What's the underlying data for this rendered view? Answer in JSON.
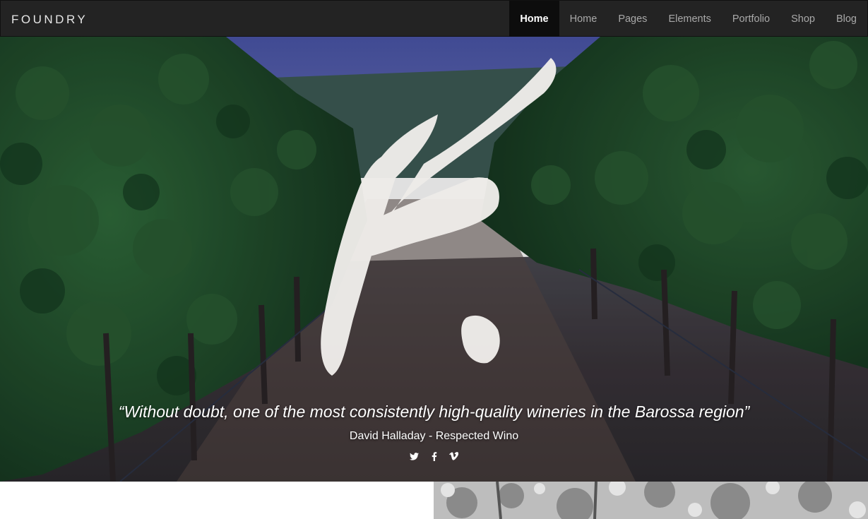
{
  "brand": {
    "logo_text": "FOUNDRY"
  },
  "nav": {
    "items": [
      {
        "label": "Home",
        "active": true
      },
      {
        "label": "Home",
        "active": false
      },
      {
        "label": "Pages",
        "active": false
      },
      {
        "label": "Elements",
        "active": false
      },
      {
        "label": "Portfolio",
        "active": false
      },
      {
        "label": "Shop",
        "active": false
      },
      {
        "label": "Blog",
        "active": false
      }
    ]
  },
  "hero": {
    "quote": "“Without doubt, one of the most consistently high-quality wineries in the Barossa region”",
    "author": "David Halladay - Respected Wino",
    "social_icons": [
      "twitter-icon",
      "facebook-icon",
      "vimeo-icon"
    ]
  },
  "colors": {
    "nav_bg": "#232323",
    "nav_active_bg": "#0d0d0d",
    "nav_text": "#a9a9a9",
    "sky": "#5b66b0",
    "foliage": "#1f4a2c"
  }
}
